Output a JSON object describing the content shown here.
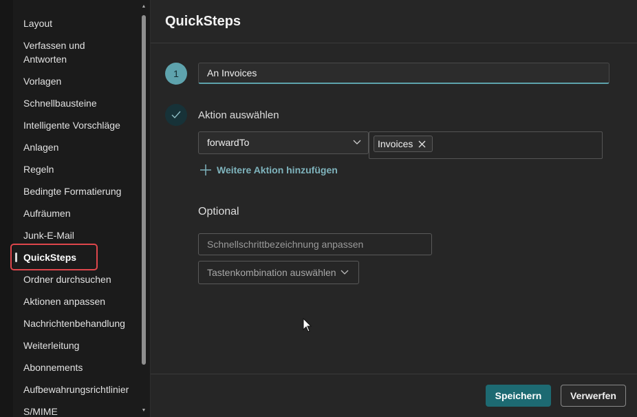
{
  "sidebar": {
    "items": [
      {
        "label": "Layout"
      },
      {
        "label": "Verfassen und"
      },
      {
        "label": "Antworten"
      },
      {
        "label": "Vorlagen"
      },
      {
        "label": "Schnellbausteine"
      },
      {
        "label": "Intelligente Vorschläge"
      },
      {
        "label": "Anlagen"
      },
      {
        "label": "Regeln"
      },
      {
        "label": "Bedingte Formatierung"
      },
      {
        "label": "Aufräumen"
      },
      {
        "label": "Junk-E-Mail"
      },
      {
        "label": "QuickSteps"
      },
      {
        "label": "Ordner durchsuchen"
      },
      {
        "label": "Aktionen anpassen"
      },
      {
        "label": "Nachrichtenbehandlung"
      },
      {
        "label": "Weiterleitung"
      },
      {
        "label": "Abonnements"
      },
      {
        "label": "Aufbewahrungsrichtlinier"
      },
      {
        "label": "S/MIME"
      }
    ],
    "active_item": "QuickSteps",
    "scroll_up_arrow": "▲",
    "scroll_down_arrow": "▼"
  },
  "main": {
    "title": "QuickSteps",
    "step_number": "1",
    "name_value": "An Invoices",
    "action_section_label": "Aktion auswählen",
    "action_select_value": "forwardTo",
    "recipient_chip": "Invoices",
    "add_action_label": "Weitere Aktion hinzufügen",
    "optional_label": "Optional",
    "custom_name_placeholder": "Schnellschrittbezeichnung anpassen",
    "shortcut_select_label": "Tastenkombination auswählen"
  },
  "footer": {
    "save_label": "Speichern",
    "discard_label": "Verwerfen"
  },
  "colors": {
    "accent": "#5ea3ad",
    "primary_button": "#1d6a72",
    "highlight_box": "#e0474c",
    "link": "#7fb4bd"
  },
  "icons": {
    "check": "check-icon",
    "chevron": "chevron-down-icon",
    "remove_chip": "close-icon",
    "add": "plus-icon",
    "cursor": "mouse-pointer-icon"
  }
}
